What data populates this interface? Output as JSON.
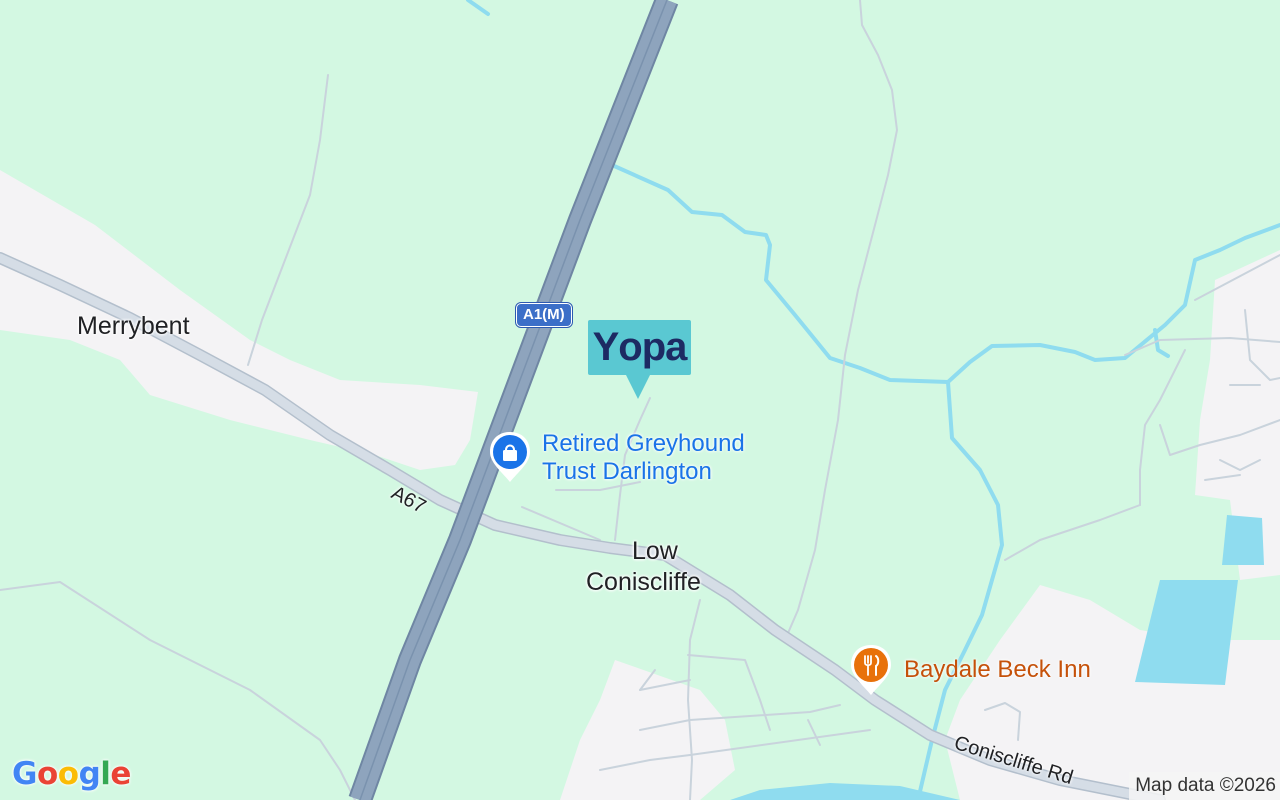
{
  "map": {
    "places": {
      "merrybent": "Merrybent",
      "low_coniscliffe_line1": "Low",
      "low_coniscliffe_line2": "Coniscliffe"
    },
    "roads": {
      "a1m": "A1(M)",
      "a67": "A67",
      "coniscliffe_rd": "Coniscliffe Rd"
    },
    "pois": {
      "greyhound_line1": "Retired Greyhound",
      "greyhound_line2": "Trust Darlington",
      "greyhound_icon": "shopping-bag-icon",
      "greyhound_color": "#1a73e8",
      "inn": "Baydale Beck Inn",
      "inn_icon": "restaurant-icon",
      "inn_color": "#e8710a"
    },
    "brand_marker": {
      "text": "Υopa",
      "background": "#5ac8d2",
      "text_color": "#1d2a63"
    },
    "attribution": "Map data ©2026",
    "logo": {
      "letters": [
        "G",
        "o",
        "o",
        "g",
        "l",
        "e"
      ],
      "colors": [
        "#4285f4",
        "#ea4335",
        "#fbbc05",
        "#4285f4",
        "#34a853",
        "#ea4335"
      ]
    },
    "colors": {
      "land": "#d3f8e2",
      "urban": "#f4f3f5",
      "water": "#8fdcef",
      "motorway": "#8ea4bd",
      "road": "#cbd5e0"
    }
  }
}
